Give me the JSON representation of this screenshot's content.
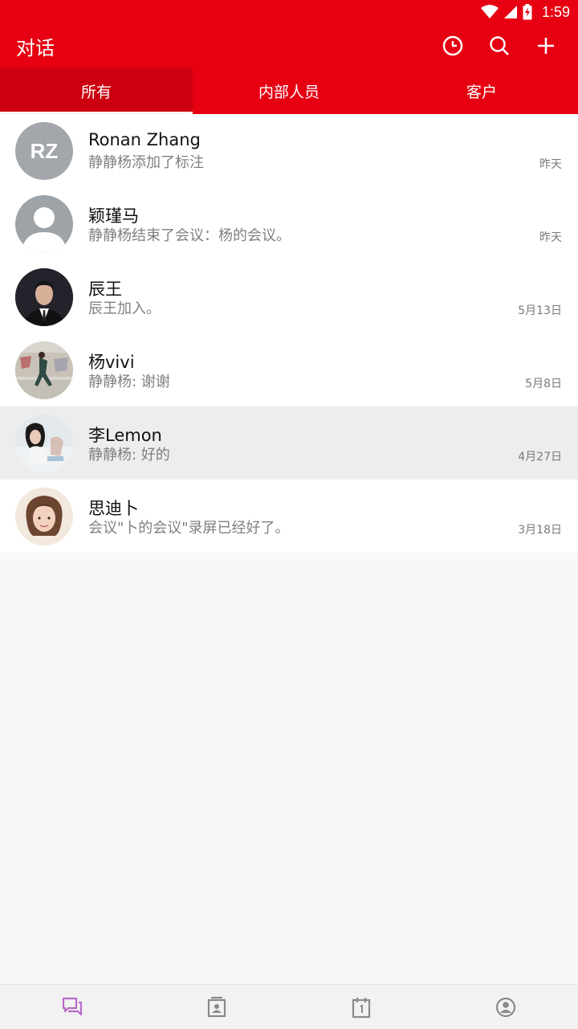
{
  "status": {
    "time": "1:59"
  },
  "app": {
    "title": "对话",
    "actions": [
      "history-icon",
      "search-icon",
      "add-icon"
    ]
  },
  "tabs": [
    {
      "label": "所有",
      "active": true
    },
    {
      "label": "内部人员",
      "active": false
    },
    {
      "label": "客户",
      "active": false
    }
  ],
  "conversations": [
    {
      "name": "Ronan Zhang",
      "message": "静静杨添加了标注",
      "time": "昨天",
      "avatar_initials": "RZ"
    },
    {
      "name": "颖瑾马",
      "message": "静静杨结束了会议：杨的会议。",
      "time": "昨天"
    },
    {
      "name": "辰王",
      "message": "辰王加入。",
      "time": "5月13日"
    },
    {
      "name": "杨vivi",
      "message": "静静杨: 谢谢",
      "time": "5月8日"
    },
    {
      "name": "李Lemon",
      "message": "静静杨: 好的",
      "time": "4月27日",
      "selected": true
    },
    {
      "name": "思迪卜",
      "message": "会议\"卜的会议\"录屏已经好了。",
      "time": "3月18日"
    }
  ],
  "bottom_nav": [
    "chat-icon",
    "contacts-icon",
    "calendar-icon",
    "profile-icon"
  ],
  "colors": {
    "primary": "#e60012",
    "tab_active": "#cc0010",
    "nav_active": "#b96ac9",
    "nav_inactive": "#8a8a8a"
  }
}
